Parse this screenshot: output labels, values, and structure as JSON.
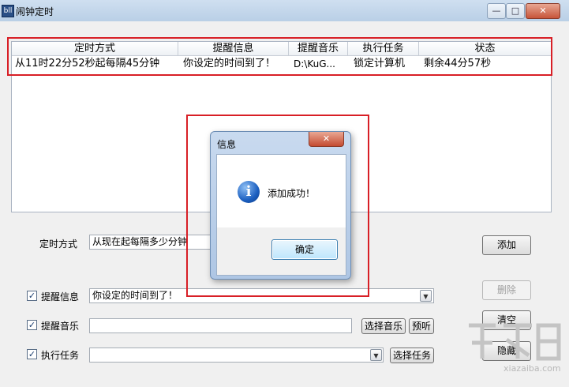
{
  "window": {
    "title": "闹钟定时",
    "icon_text": "bll",
    "minimize_glyph": "—",
    "maximize_glyph": "□",
    "close_glyph": "✕"
  },
  "list": {
    "headers": [
      "定时方式",
      "提醒信息",
      "提醒音乐",
      "执行任务",
      "状态"
    ],
    "rows": [
      {
        "mode": "从11时22分52秒起每隔45分钟",
        "message": "你设定的时间到了！",
        "music": "D:\\KuG...",
        "task": "锁定计算机",
        "status": "剩余44分57秒"
      }
    ]
  },
  "form": {
    "mode_label": "定时方式",
    "mode_value": "从现在起每隔多少分钟",
    "message_label": "提醒信息",
    "message_value": "你设定的时间到了！",
    "music_label": "提醒音乐",
    "music_value": "",
    "task_label": "执行任务",
    "task_value": "",
    "select_music_button": "选择音乐",
    "preview_button": "预听",
    "select_task_button": "选择任务",
    "checkbox_glyph": "✓",
    "dropdown_glyph": "▼"
  },
  "side_buttons": {
    "add": "添加",
    "delete": "删除",
    "clear": "清空",
    "hide": "隐藏"
  },
  "dialog": {
    "title": "信息",
    "message": "添加成功！",
    "ok": "确定",
    "close_glyph": "✕",
    "icon_glyph": "i"
  },
  "watermark": {
    "text": "xiazaiba.com"
  },
  "colors": {
    "highlight": "#d81f26"
  }
}
